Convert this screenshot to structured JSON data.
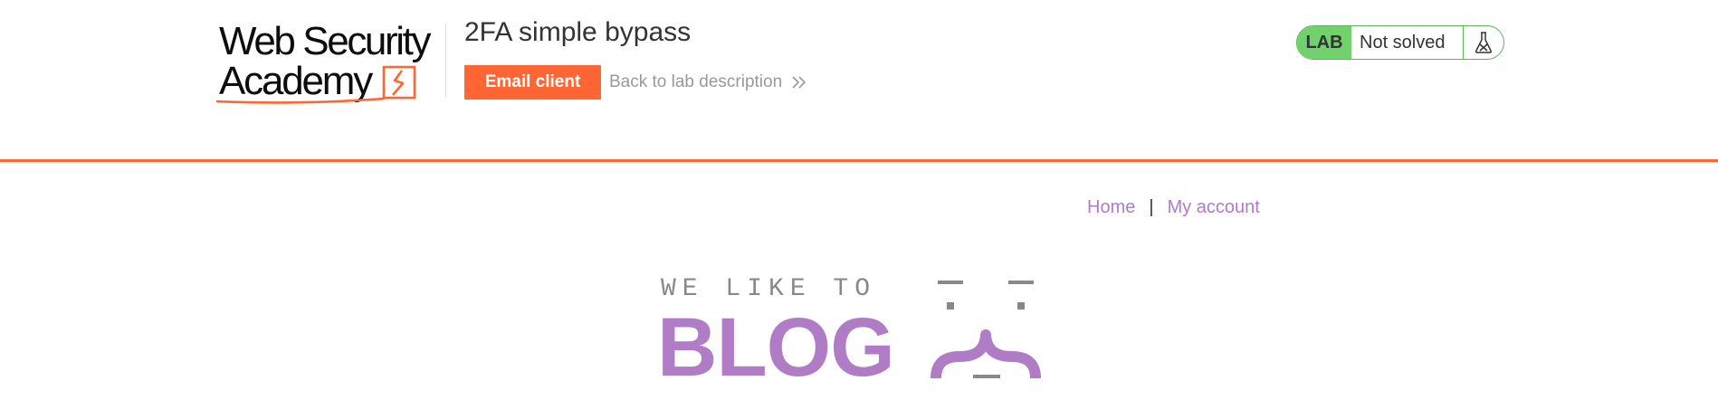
{
  "header": {
    "logo": {
      "line1": "Web Security",
      "line2": "Academy"
    },
    "lab_title": "2FA simple bypass",
    "email_button_label": "Email client",
    "back_link_label": "Back to lab description",
    "status": {
      "tag": "LAB",
      "text": "Not solved"
    }
  },
  "nav": {
    "items": [
      {
        "label": "Home"
      },
      {
        "label": "My account"
      }
    ],
    "separator": "|"
  },
  "banner": {
    "tagline": "WE LIKE TO",
    "word": "BLOG"
  },
  "colors": {
    "accent": "#ff6633",
    "blog_purple": "#b07cc6",
    "status_green": "#70d16d",
    "muted_gray": "#999999"
  },
  "icons": {
    "logo_mark": "academy-lightning-logo",
    "back_chevrons": "double-chevron-right-icon",
    "status_icon": "flask-icon"
  }
}
